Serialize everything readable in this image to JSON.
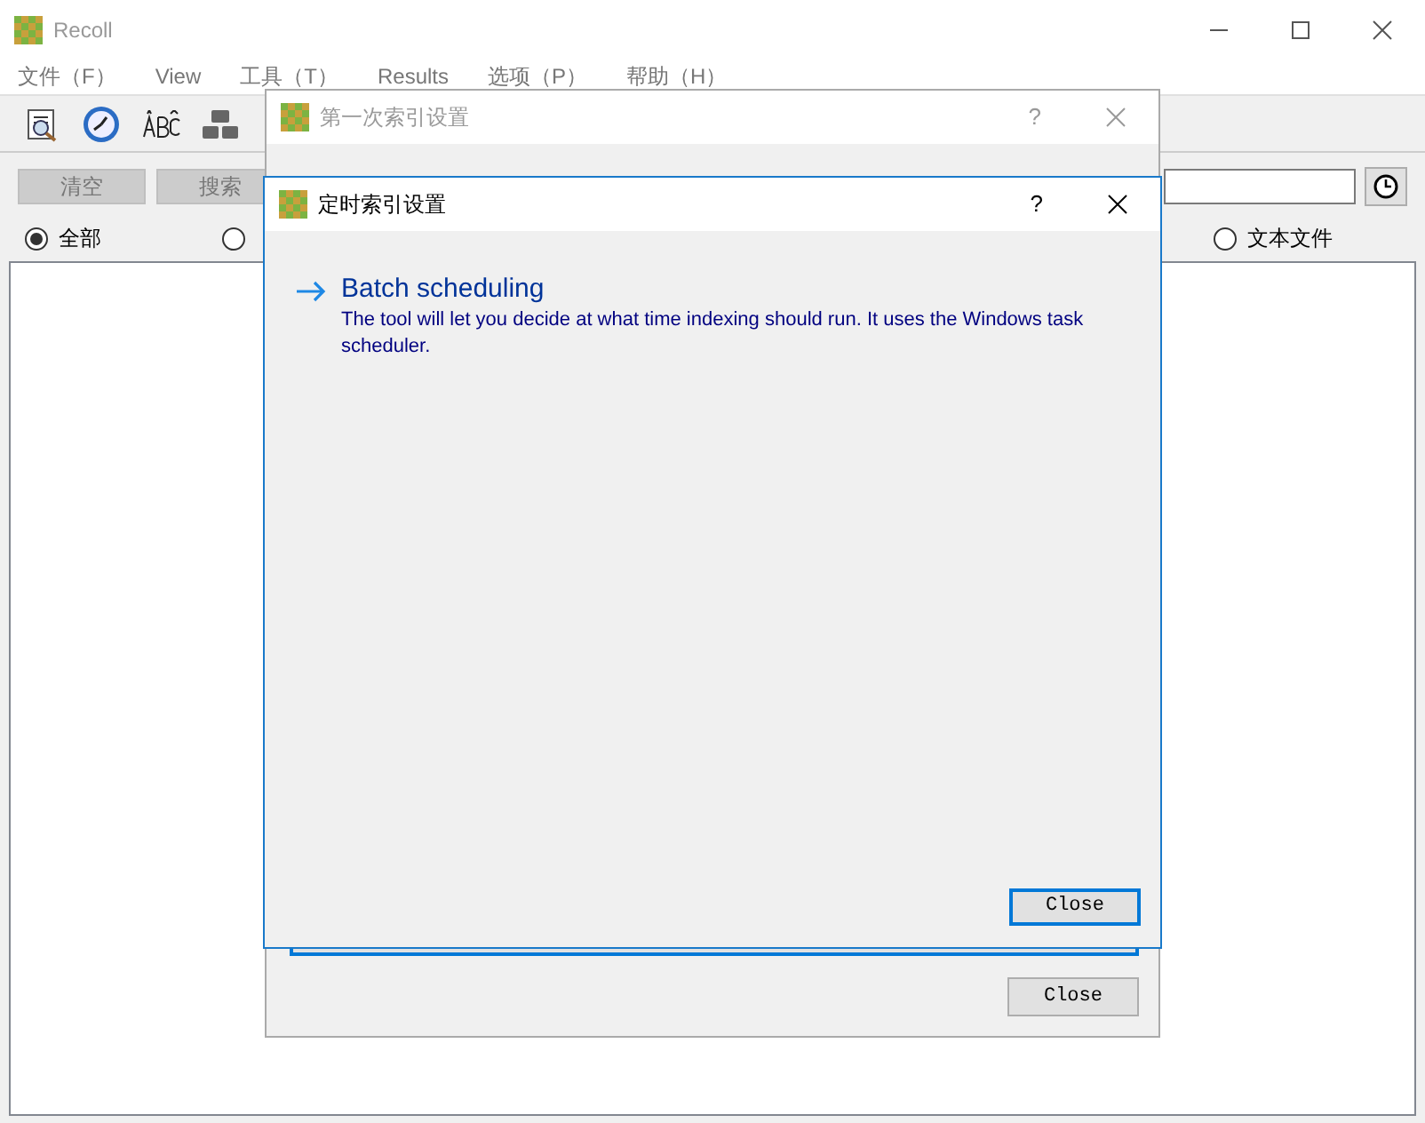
{
  "main_window": {
    "title": "Recoll",
    "menu": [
      "文件（F）",
      "View",
      "工具（T）",
      "Results",
      "选项（P）",
      "帮助（H）"
    ],
    "buttons": [
      {
        "label": "清空",
        "disabled": true
      },
      {
        "label": "搜索",
        "disabled": true
      }
    ],
    "filters": [
      {
        "label": "全部",
        "selected": true
      },
      {
        "selected": false
      },
      {
        "label": "文本文件",
        "selected": false
      }
    ]
  },
  "first_index_dialog": {
    "title": "第一次索引设置",
    "help": "?",
    "close_button": "Close"
  },
  "scheduling_dialog": {
    "title": "定时索引设置",
    "help": "?",
    "option": {
      "title": "Batch scheduling",
      "description": "The tool will let you decide at what time indexing should run.  It uses the Windows task scheduler."
    },
    "close_button": "Close"
  }
}
